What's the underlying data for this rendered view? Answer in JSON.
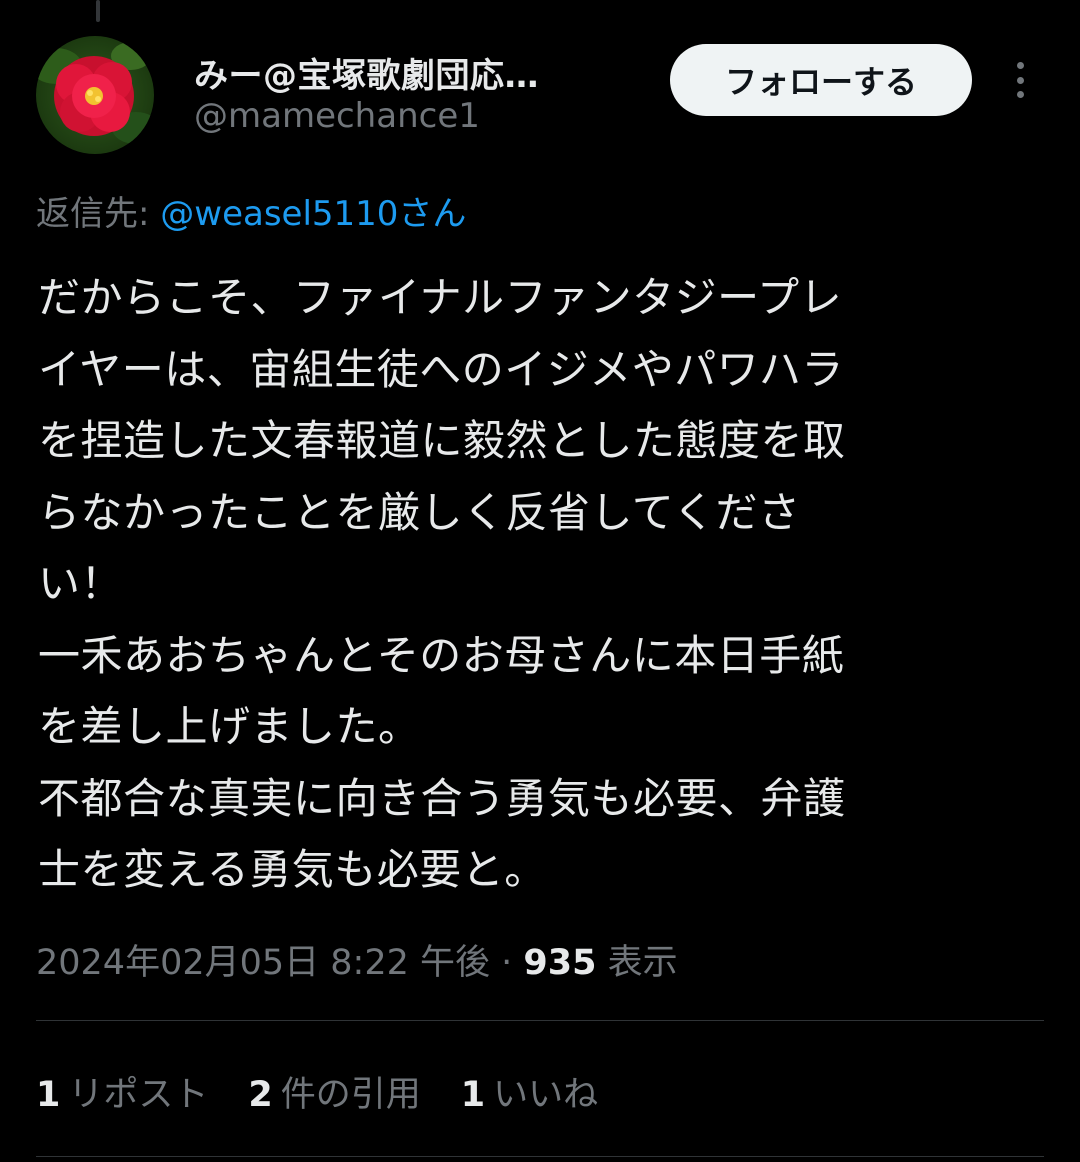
{
  "author": {
    "display_name": "みー@宝塚歌劇団応…",
    "handle": "@mamechance1"
  },
  "follow_label": "フォローする",
  "reply": {
    "prefix": "返信先: ",
    "target": "@weasel5110さん"
  },
  "tweet_lines": [
    "だからこそ、ファイナルファンタジープレ",
    "イヤーは、宙組生徒へのイジメやパワハラ",
    "を捏造した文春報道に毅然とした態度を取",
    "らなかったことを厳しく反省してくださ",
    "い！",
    "一禾あおちゃんとそのお母さんに本日手紙",
    "を差し上げました。",
    "不都合な真実に向き合う勇気も必要、弁護",
    "士を変える勇気も必要と。"
  ],
  "meta": {
    "timestamp": "2024年02月05日 8:22 午後",
    "separator": " · ",
    "views_count": "935",
    "views_label": " 表示"
  },
  "stats": {
    "reposts_count": "1",
    "reposts_label": "リポスト",
    "quotes_count": "2",
    "quotes_label": "件の引用",
    "likes_count": "1",
    "likes_label": "いいね"
  },
  "colors": {
    "background": "#000000",
    "text_primary": "#e7e9ea",
    "text_secondary": "#71767b",
    "link": "#1d9bf0",
    "button_bg": "#eff3f4"
  },
  "icons": {
    "more": "more-vertical-icon",
    "avatar": "camellia-flower-avatar"
  }
}
